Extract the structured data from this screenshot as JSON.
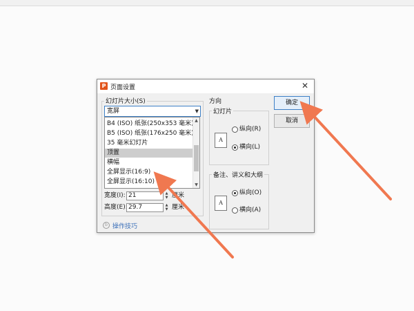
{
  "dialog": {
    "title": "页面设置",
    "app_icon_text": "P",
    "close_label": "✕"
  },
  "slide_size": {
    "group_label": "幻灯片大小(S)",
    "selected_value": "宽屏",
    "options": [
      "B4 (ISO) 纸张(250x353 毫米)",
      "B5 (ISO) 纸张(176x250 毫米)",
      "35 毫米幻灯片",
      "顶置",
      "横幅",
      "全屏显示(16:9)",
      "全屏显示(16:10)"
    ],
    "highlighted_index": 3
  },
  "dimensions": {
    "width_label": "宽度(I):",
    "width_value": "21",
    "height_label": "高度(E):",
    "height_value": "29.7",
    "unit": "厘米"
  },
  "tips": {
    "label": "操作技巧"
  },
  "orientation": {
    "title": "方向",
    "slides": {
      "label": "幻灯片",
      "portrait": "纵向(R)",
      "landscape": "横向(L)",
      "selected": "landscape"
    },
    "notes": {
      "label": "备注、讲义和大纲",
      "portrait": "纵向(O)",
      "landscape": "横向(A)",
      "selected": "portrait"
    },
    "page_icon_glyph": "A"
  },
  "buttons": {
    "ok": "确定",
    "cancel": "取消"
  },
  "colors": {
    "accent": "#3c7fc6",
    "arrow": "#f07850",
    "app_icon": "#e2541b"
  }
}
